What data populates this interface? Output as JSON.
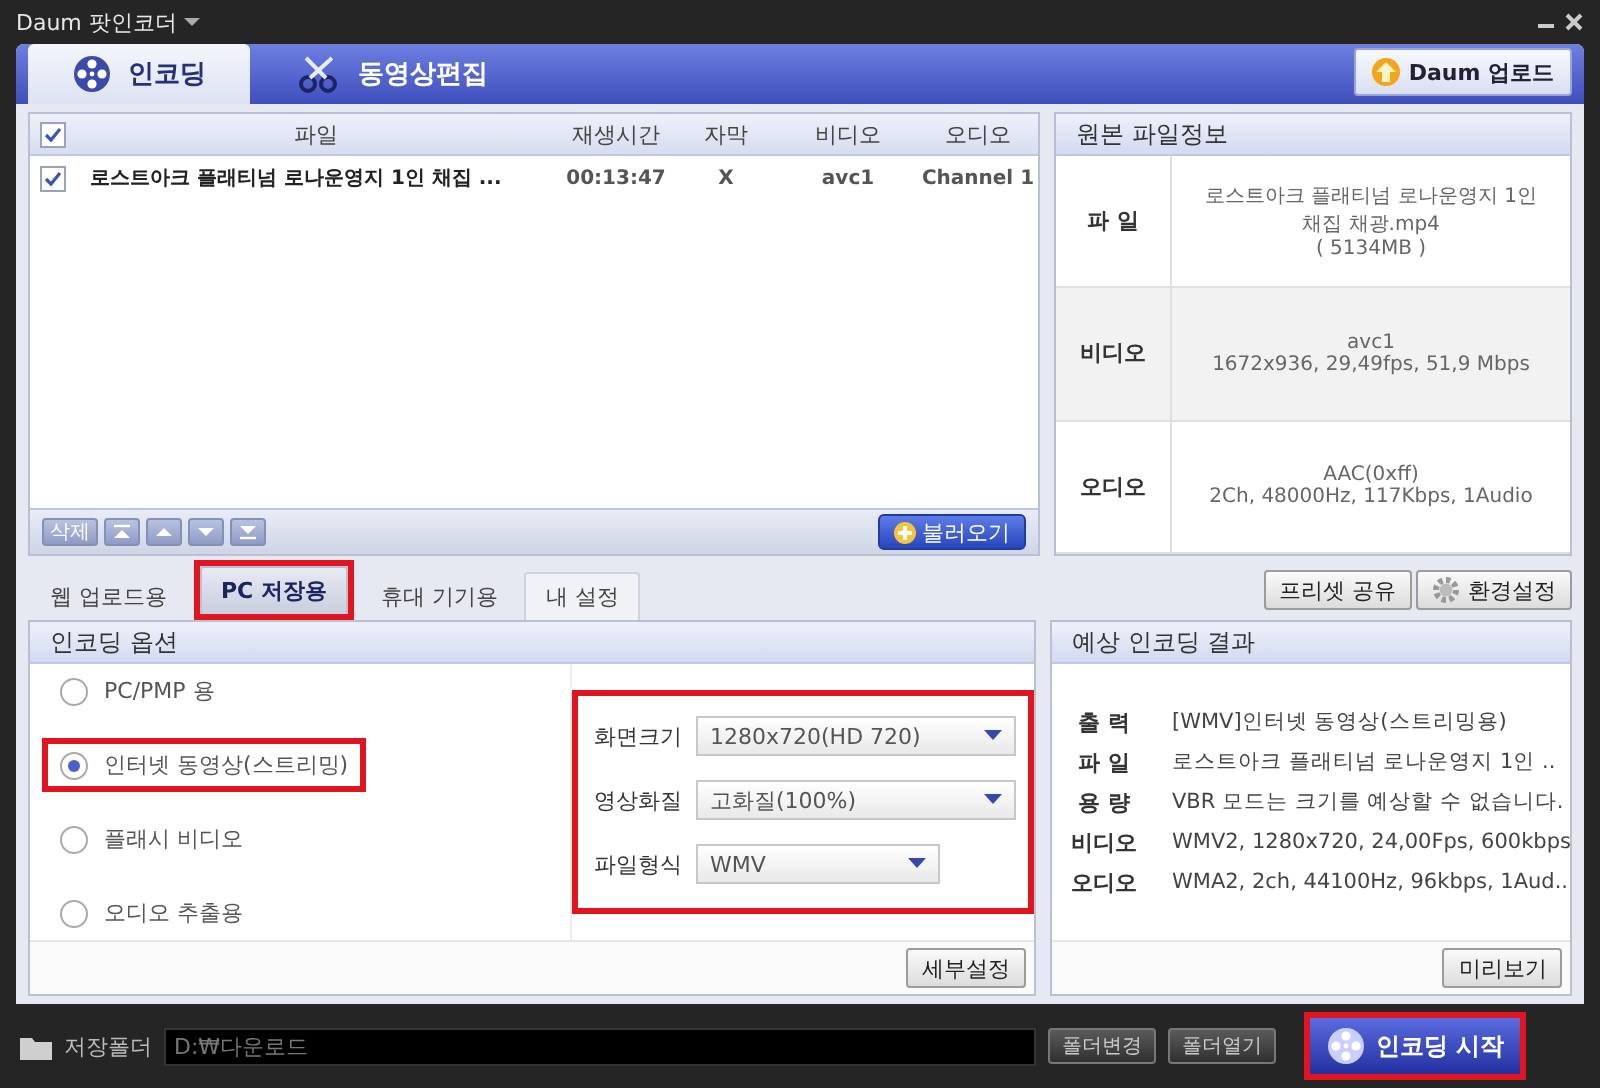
{
  "window": {
    "title": "Daum 팟인코더"
  },
  "main_tabs": [
    {
      "label": "인코딩",
      "kind": "reel",
      "selected": true
    },
    {
      "label": "동영상편집",
      "kind": "scissors",
      "selected": false
    }
  ],
  "upload_button": "Daum 업로드",
  "file_list": {
    "all_checked": true,
    "columns": [
      "파일",
      "재생시간",
      "자막",
      "비디오",
      "오디오"
    ],
    "rows": [
      {
        "checked": true,
        "cells": [
          "로스트아크 플래티넘 로나운영지 1인 채집 ...",
          "00:13:47",
          "X",
          "avc1",
          "Channel 1"
        ]
      }
    ],
    "delete_button": "삭제",
    "load_button": "불러오기"
  },
  "source_info": {
    "title": "원본 파일정보",
    "rows": [
      {
        "label": "파 일",
        "lines": [
          "로스트아크 플래티넘 로나운영지 1인 채집 채광.mp4",
          "( 5134MB )"
        ]
      },
      {
        "label": "비디오",
        "lines": [
          "avc1",
          "1672x936, 29,49fps, 51,9 Mbps"
        ]
      },
      {
        "label": "오디오",
        "lines": [
          "AAC(0xff)",
          "2Ch, 48000Hz, 117Kbps, 1Audio"
        ]
      }
    ]
  },
  "preset_tabs": [
    {
      "label": "웹 업로드용",
      "selected": false,
      "highlighted": false
    },
    {
      "label": "PC 저장용",
      "selected": true,
      "highlighted": true
    },
    {
      "label": "휴대 기기용",
      "selected": false,
      "highlighted": false
    },
    {
      "label": "내 설정",
      "selected": false,
      "highlighted": false
    }
  ],
  "preset_share_button": "프리셋 공유",
  "settings_button": "환경설정",
  "encoding_options": {
    "title": "인코딩 옵션",
    "modes": [
      {
        "label": "PC/PMP 용",
        "selected": false,
        "highlighted": false
      },
      {
        "label": "인터넷 동영상(스트리밍)",
        "selected": true,
        "highlighted": true
      },
      {
        "label": "플래시 비디오",
        "selected": false,
        "highlighted": false
      },
      {
        "label": "오디오 추출용",
        "selected": false,
        "highlighted": false
      }
    ],
    "settings_highlighted": true,
    "settings": [
      {
        "label": "화면크기",
        "value": "1280x720(HD 720)",
        "kind": "wide"
      },
      {
        "label": "영상화질",
        "value": "고화질(100%)",
        "kind": "wide"
      },
      {
        "label": "파일형식",
        "value": "WMV",
        "kind": "narrow"
      }
    ],
    "detail_button": "세부설정"
  },
  "expected_result": {
    "title": "예상 인코딩 결과",
    "rows": [
      {
        "label": "출 력",
        "value": "[WMV]인터넷 동영상(스트리밍용)"
      },
      {
        "label": "파 일",
        "value": "로스트아크 플래티넘 로나운영지 1인 .."
      },
      {
        "label": "용 량",
        "value": "VBR 모드는 크기를 예상할 수 없습니다."
      },
      {
        "label": "비디오",
        "value": "WMV2, 1280x720, 24,00Fps, 600kbps"
      },
      {
        "label": "오디오",
        "value": "WMA2, 2ch, 44100Hz, 96kbps, 1Aud.."
      }
    ],
    "preview_button": "미리보기"
  },
  "footer": {
    "label": "저장폴더",
    "path": "D:₩다운로드",
    "buttons": [
      "폴더변경",
      "폴더열기"
    ],
    "start_button": {
      "label": "인코딩 시작",
      "highlighted": true
    }
  }
}
